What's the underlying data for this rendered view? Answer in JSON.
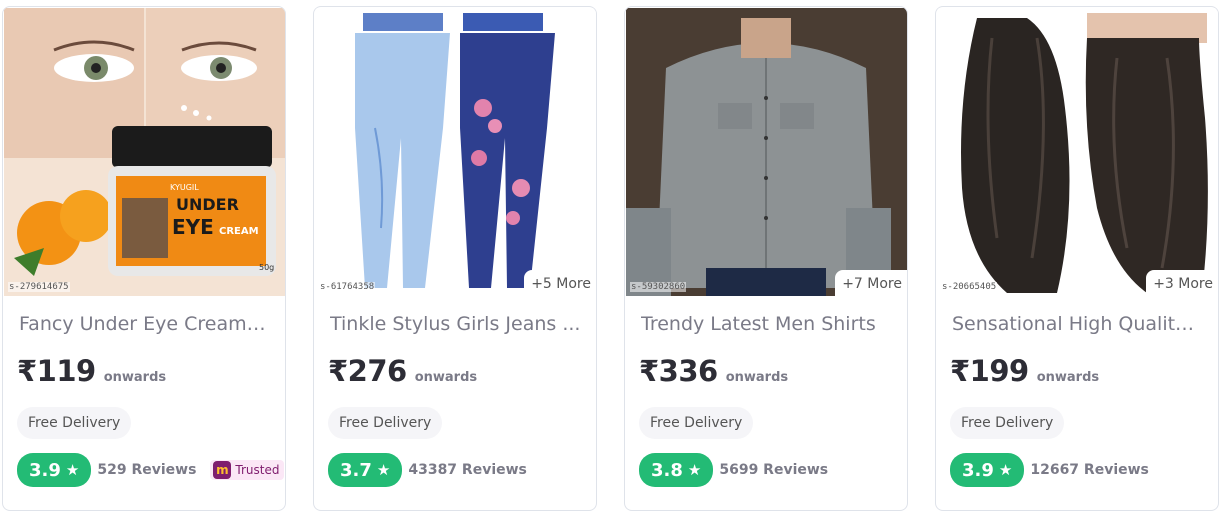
{
  "products": [
    {
      "name": "Fancy Under Eye Cream/...",
      "sku": "s-279614675",
      "more": "",
      "price": "₹119",
      "onwards": "onwards",
      "delivery": "Free Delivery",
      "rating": "3.9",
      "reviews": "529 Reviews",
      "trusted": "Trusted",
      "trusted_logo": "m",
      "product_image_text": [
        "KYUGIL",
        "UNDER",
        "EYE",
        "CREAM",
        "50g"
      ]
    },
    {
      "name": "Tinkle Stylus Girls Jeans ...",
      "sku": "s-61764358",
      "more": "+5 More",
      "price": "₹276",
      "onwards": "onwards",
      "delivery": "Free Delivery",
      "rating": "3.7",
      "reviews": "43387 Reviews"
    },
    {
      "name": "Trendy Latest Men Shirts",
      "sku": "s-59302860",
      "more": "+7 More",
      "price": "₹336",
      "onwards": "onwards",
      "delivery": "Free Delivery",
      "rating": "3.8",
      "reviews": "5699 Reviews"
    },
    {
      "name": "Sensational High Quality ...",
      "sku": "s-20665405",
      "more": "+3 More",
      "price": "₹199",
      "onwards": "onwards",
      "delivery": "Free Delivery",
      "rating": "3.9",
      "reviews": "12667 Reviews"
    }
  ],
  "icons": {
    "star": "★",
    "star_icon_name": "star-icon"
  },
  "colors": {
    "rating_green": "#23bb75",
    "trusted_purple": "#7f1d6e"
  }
}
